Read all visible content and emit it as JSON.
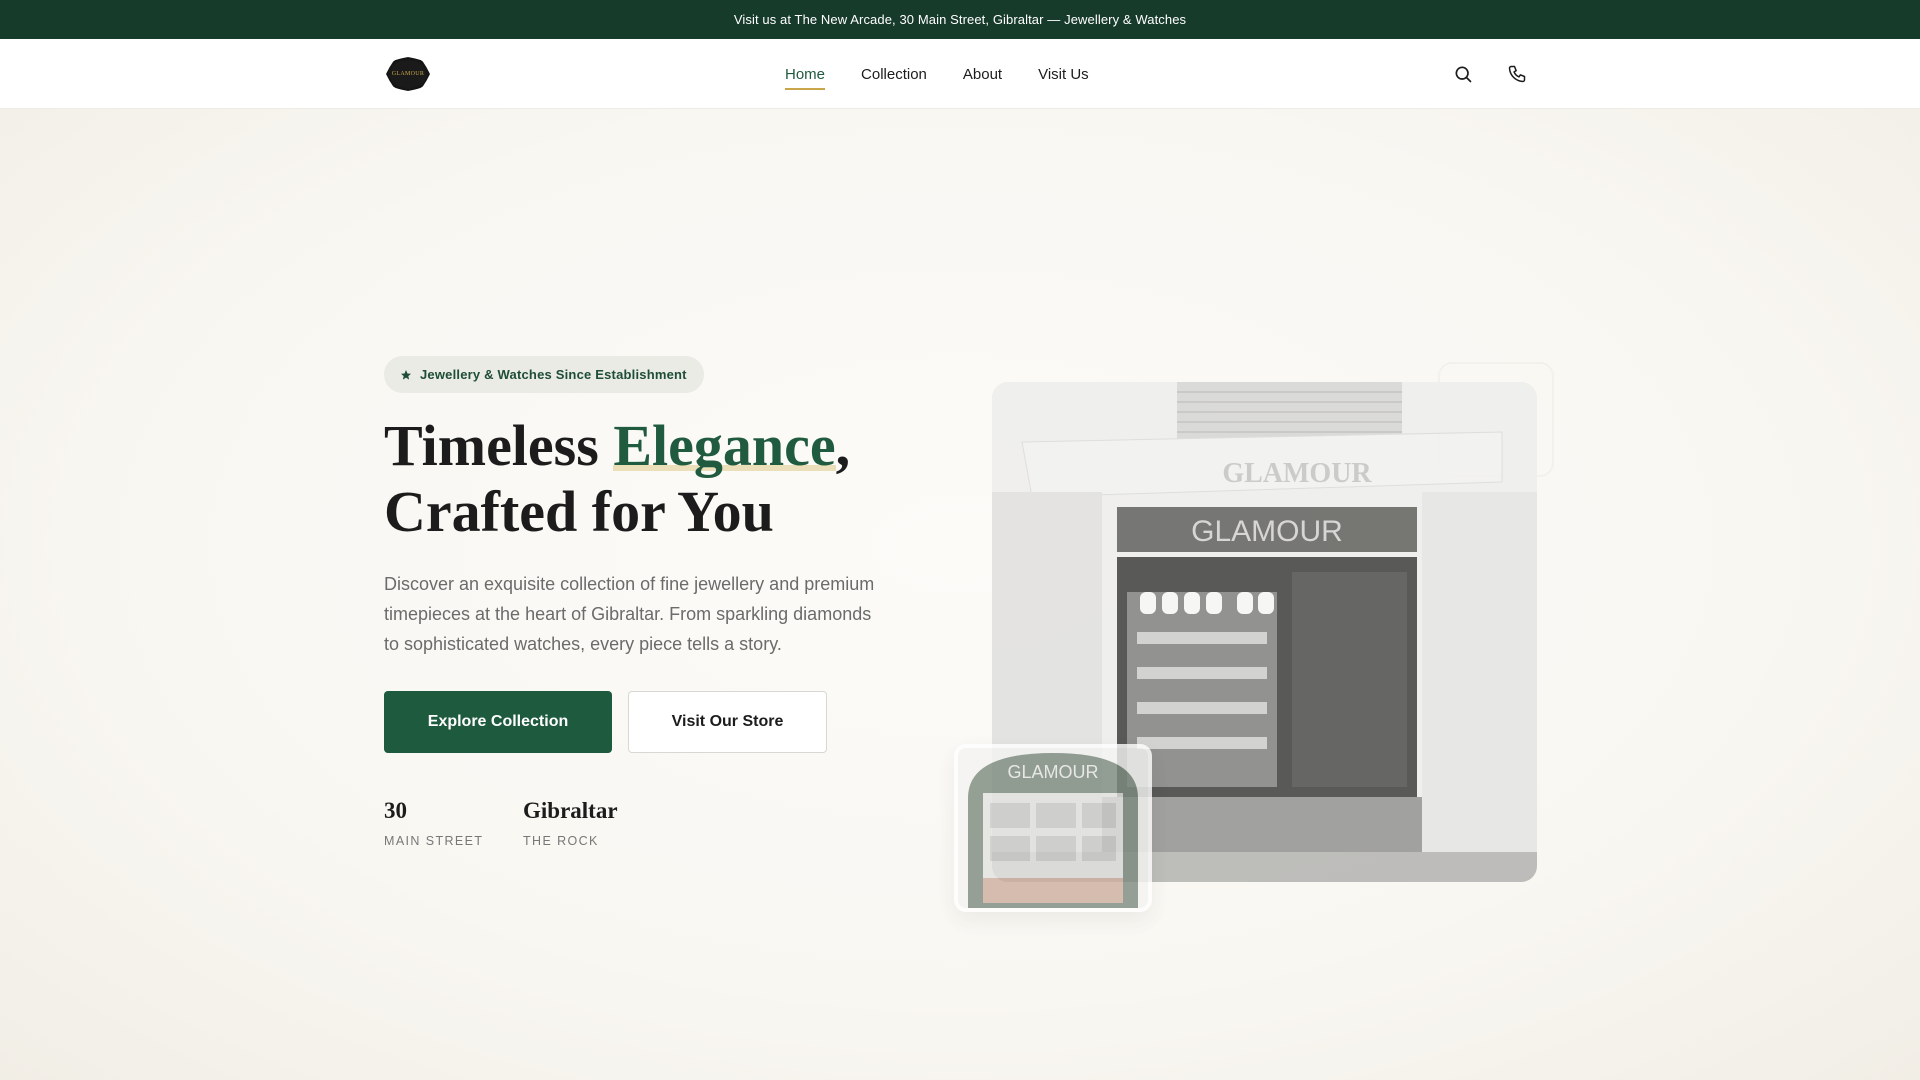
{
  "announcement": "Visit us at The New Arcade, 30 Main Street, Gibraltar — Jewellery & Watches",
  "logo": {
    "text": "GLAMOUR"
  },
  "nav": {
    "items": [
      {
        "label": "Home",
        "active": true
      },
      {
        "label": "Collection",
        "active": false
      },
      {
        "label": "About",
        "active": false
      },
      {
        "label": "Visit Us",
        "active": false
      }
    ],
    "icons": [
      "search-icon",
      "phone-icon"
    ]
  },
  "hero": {
    "badge": "Jewellery & Watches Since Establishment",
    "badge_icon": "star-icon",
    "title_part1": "Timeless ",
    "title_accent": "Elegance",
    "title_part2": ",",
    "title_line2": "Crafted for You",
    "description": "Discover an exquisite collection of fine jewellery and premium timepieces at the heart of Gibraltar. From sparkling diamonds to sophisticated watches, every piece tells a story.",
    "primary_button": "Explore Collection",
    "secondary_button": "Visit Our Store",
    "stats": [
      {
        "value": "30",
        "label": "MAIN STREET"
      },
      {
        "value": "Gibraltar",
        "label": "THE ROCK"
      }
    ]
  },
  "store_photo": {
    "sign_top": "GLAMOUR",
    "sign_front": "GLAMOUR",
    "thumb_sign": "GLAMOUR"
  },
  "colors": {
    "brand_green": "#1d5a3e",
    "topbar": "#173b2b",
    "gold": "#c9a64a",
    "background": "#fbfaf7"
  }
}
